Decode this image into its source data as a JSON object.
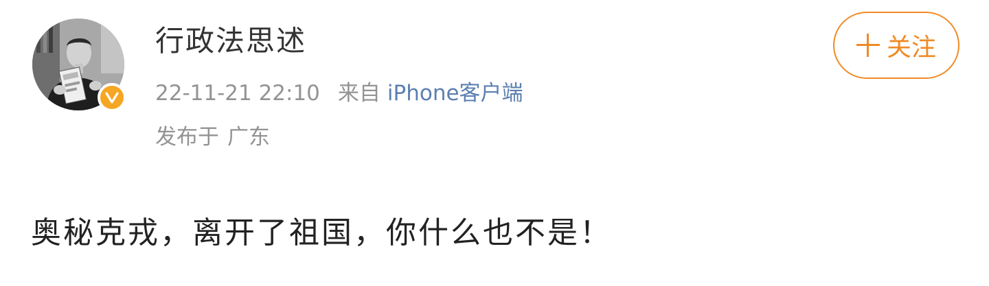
{
  "user": {
    "name": "行政法思述",
    "verified": true,
    "badge_color": "#f5a623",
    "avatar_icon": "person-reading-book-avatar"
  },
  "meta": {
    "timestamp": "22-11-21 22:10",
    "source_prefix": "来自",
    "source": "iPhone客户端",
    "location_prefix": "发布于",
    "location": "广东"
  },
  "follow_button": {
    "icon": "plus-icon",
    "label": "关注",
    "color": "#f08a24"
  },
  "post": {
    "text": "奥秘克戎，离开了祖国，你什么也不是！"
  }
}
